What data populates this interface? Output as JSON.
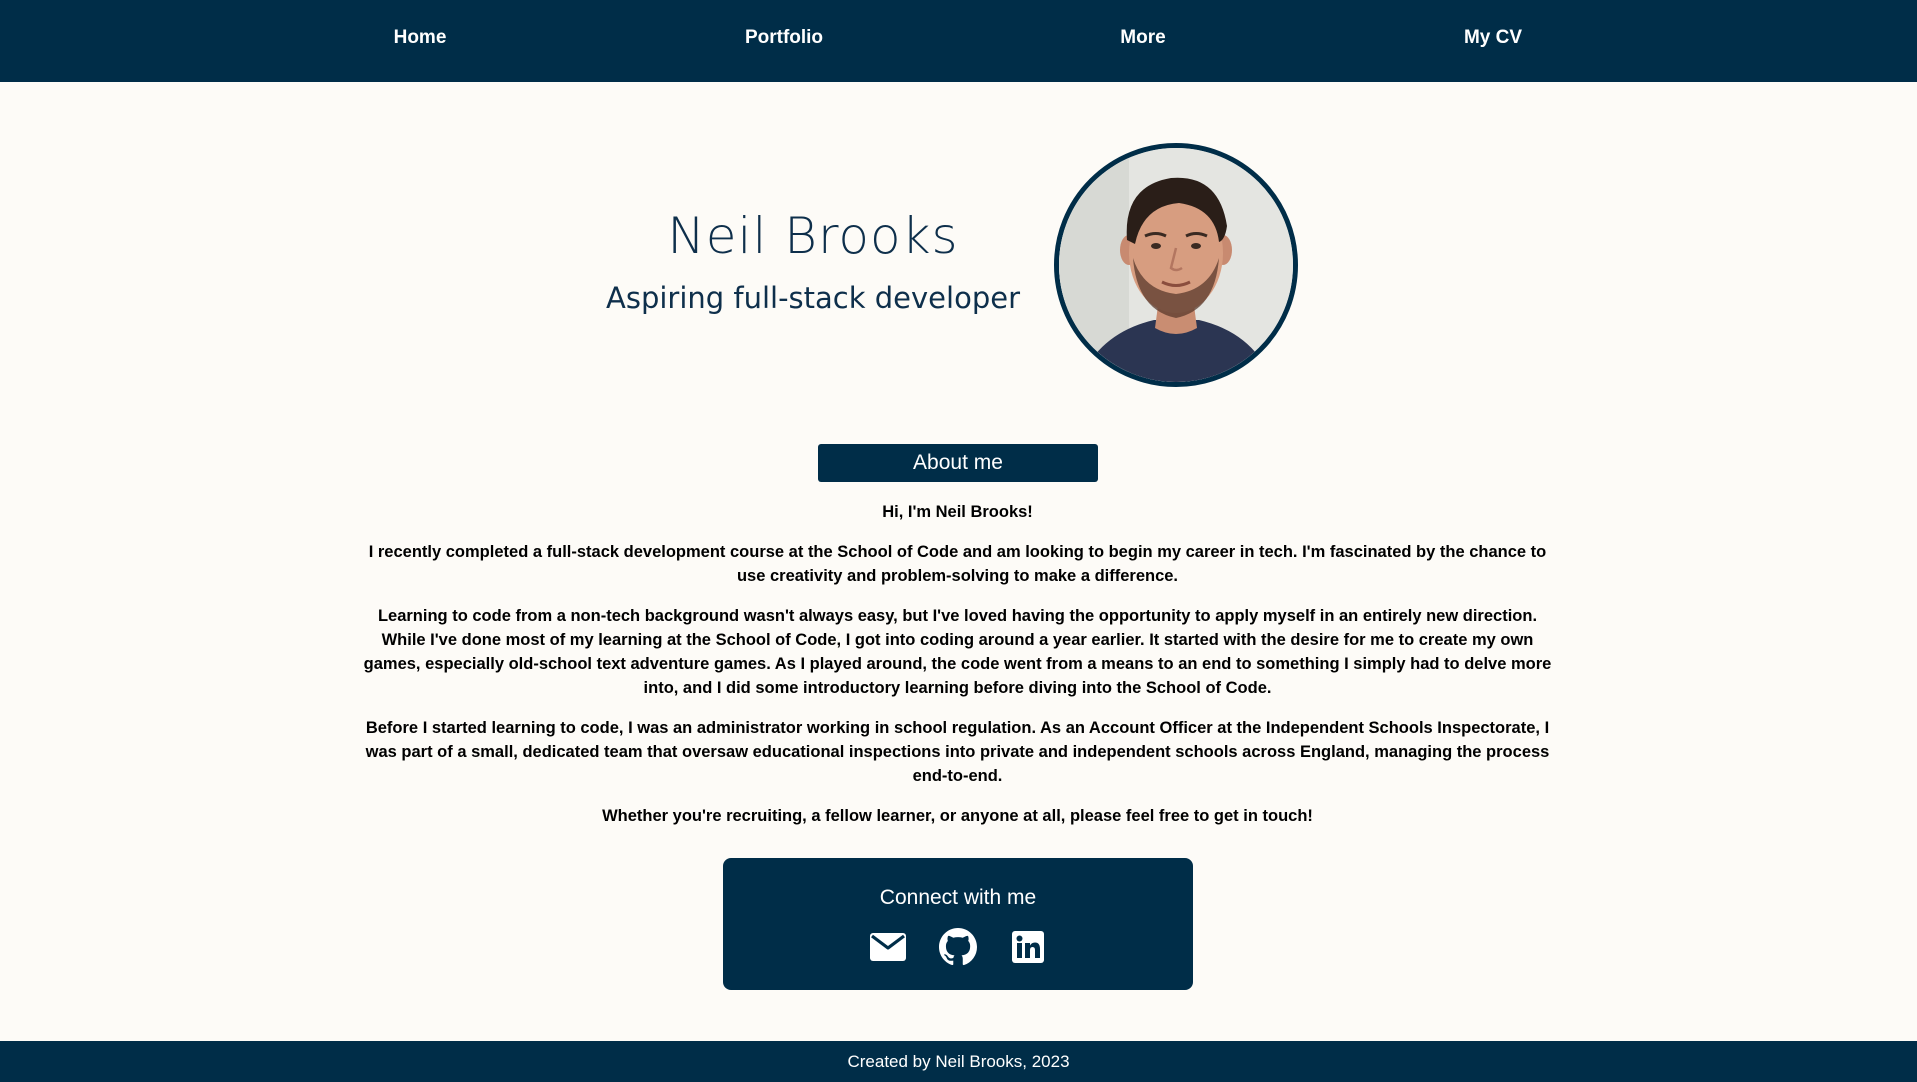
{
  "nav": {
    "items": [
      {
        "label": "Home"
      },
      {
        "label": "Portfolio"
      },
      {
        "label": "More"
      },
      {
        "label": "My CV"
      }
    ]
  },
  "hero": {
    "name": "Neil Brooks",
    "subtitle": "Aspiring full-stack developer"
  },
  "about": {
    "heading": "About me",
    "paragraphs": [
      "Hi, I'm Neil Brooks!",
      "I recently completed a full-stack development course at the School of Code and am looking to begin my career in tech. I'm fascinated by the chance to use creativity and problem-solving to make a difference.",
      "Learning to code from a non-tech background wasn't always easy, but I've loved having the opportunity to apply myself in an entirely new direction. While I've done most of my learning at the School of Code, I got into coding around a year earlier. It started with the desire for me to create my own games, especially old-school text adventure games. As I played around, the code went from a means to an end to something I simply had to delve more into, and I did some introductory learning before diving into the School of Code.",
      "Before I started learning to code, I was an administrator working in school regulation. As an Account Officer at the Independent Schools Inspectorate, I was part of a small, dedicated team that oversaw educational inspections into private and independent schools across England, managing the process end-to-end.",
      "Whether you're recruiting, a fellow learner, or anyone at all, please feel free to get in touch!"
    ]
  },
  "connect": {
    "title": "Connect with me",
    "icons": [
      "email-icon",
      "github-icon",
      "linkedin-icon"
    ]
  },
  "footer": {
    "text": "Created by Neil Brooks, 2023"
  },
  "colors": {
    "navy": "#002d48",
    "background": "#fdfbf7",
    "heading_text": "#0e2f4b"
  }
}
